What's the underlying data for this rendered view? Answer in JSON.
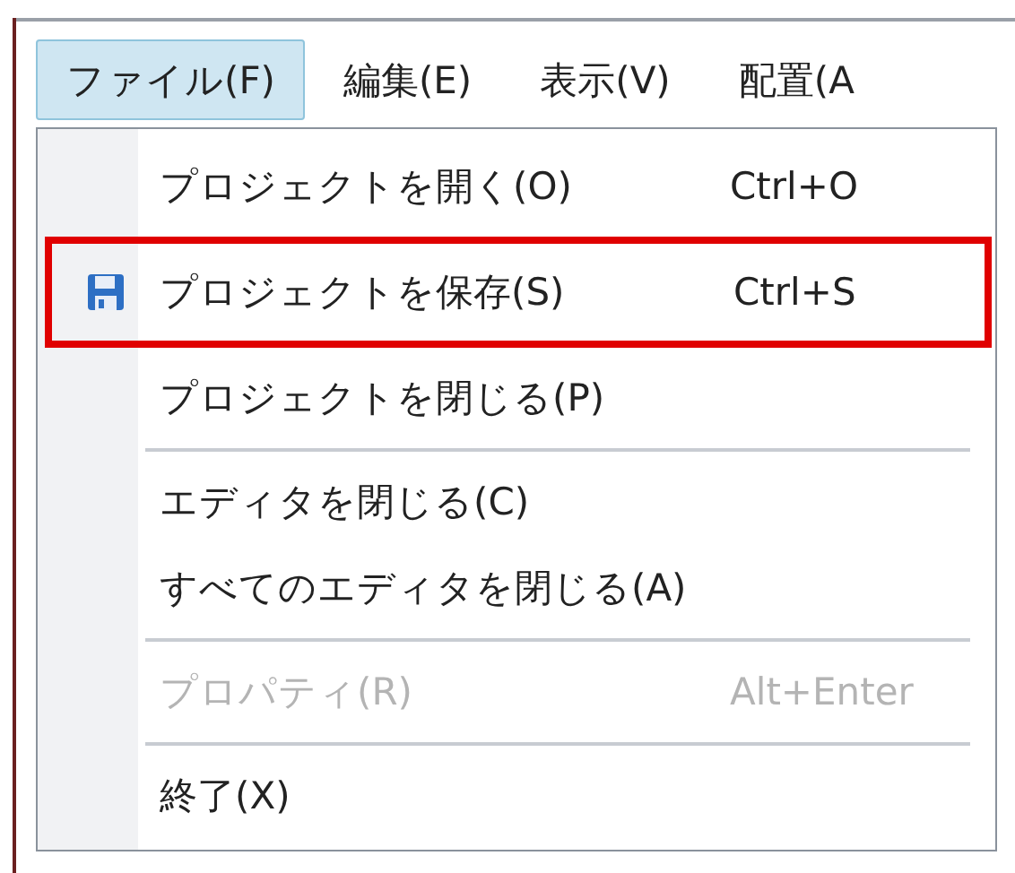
{
  "menubar": [
    {
      "label": "ファイル(F)",
      "selected": true
    },
    {
      "label": "編集(E)",
      "selected": false
    },
    {
      "label": "表示(V)",
      "selected": false
    },
    {
      "label": "配置(A",
      "selected": false
    }
  ],
  "menu": {
    "items": [
      {
        "kind": "item",
        "label": "プロジェクトを開く(O)",
        "shortcut": "Ctrl+O",
        "disabled": false,
        "highlighted": false
      },
      {
        "kind": "icon-item",
        "label": "プロジェクトを保存(S)",
        "shortcut": "Ctrl+S",
        "disabled": false,
        "highlighted": true
      },
      {
        "kind": "item",
        "label": "プロジェクトを閉じる(P)",
        "disabled": false,
        "highlighted": false
      },
      {
        "kind": "separator"
      },
      {
        "kind": "item",
        "label": "エディタを閉じる(C)",
        "disabled": false,
        "highlighted": false
      },
      {
        "kind": "item",
        "label": "すべてのエディタを閉じる(A)",
        "disabled": false,
        "highlighted": false
      },
      {
        "kind": "separator"
      },
      {
        "kind": "item",
        "label": "プロパティ(R)",
        "shortcut": "Alt+Enter",
        "disabled": true,
        "highlighted": false
      },
      {
        "kind": "separator"
      },
      {
        "kind": "item",
        "label": "終了(X)",
        "disabled": false,
        "highlighted": false
      }
    ]
  }
}
